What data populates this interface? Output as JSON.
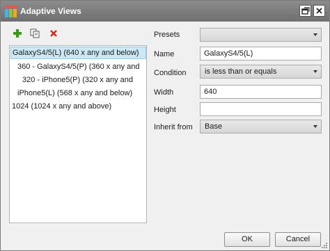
{
  "window": {
    "title": "Adaptive Views"
  },
  "toolbar": {
    "add_icon": "plus-icon",
    "copy_icon": "copy-icon",
    "delete_icon": "delete-icon"
  },
  "views": [
    "GalaxyS4/5(L) (640 x any and below)",
    "360 - GalaxyS4/5(P) (360 x any and",
    "320 - iPhone5(P) (320 x any and",
    "iPhone5(L) (568 x any and below)",
    "1024 (1024 x any and above)"
  ],
  "form": {
    "presets_label": "Presets",
    "presets_value": "",
    "name_label": "Name",
    "name_value": "GalaxyS4/5(L)",
    "condition_label": "Condition",
    "condition_value": "is less than or equals",
    "width_label": "Width",
    "width_value": "640",
    "height_label": "Height",
    "height_value": "",
    "inherit_label": "Inherit from",
    "inherit_value": "Base"
  },
  "buttons": {
    "ok": "OK",
    "cancel": "Cancel"
  },
  "colors": {
    "titlebar": "#7d7d7d",
    "selection": "#cde8f5",
    "add": "#3a9a1e",
    "delete": "#d9261c"
  }
}
